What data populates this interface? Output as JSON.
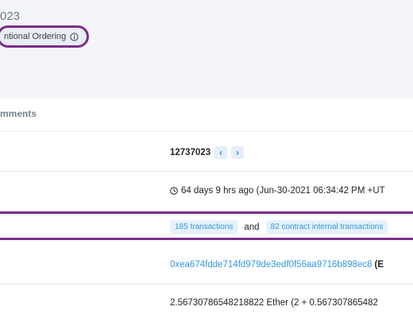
{
  "header": {
    "block_number_partial": "023",
    "ordering_label": "ntional Ordering",
    "info_icon": "info-circle-icon"
  },
  "tabs": {
    "comments_label": "mments"
  },
  "block": {
    "number": "12737023",
    "prev_label": "‹",
    "next_label": "›"
  },
  "timestamp": {
    "icon": "clock-icon",
    "text": "64 days 9 hrs ago (Jun-30-2021 06:34:42 PM +UT"
  },
  "transactions": {
    "tx_count_label": "185 transactions",
    "and_label": "and",
    "internal_count_label": "82 contract internal transactions"
  },
  "miner": {
    "address": "0xea674fdde714fd979de3edf0f56aa9716b898ec8",
    "suffix": "(E"
  },
  "reward": {
    "text": "2.56730786548218822 Ether (2 + 0.567307865482"
  },
  "colors": {
    "link_blue": "#3498db",
    "highlight_purple": "#7b2d8b",
    "header_bg": "#f3f5f9"
  }
}
